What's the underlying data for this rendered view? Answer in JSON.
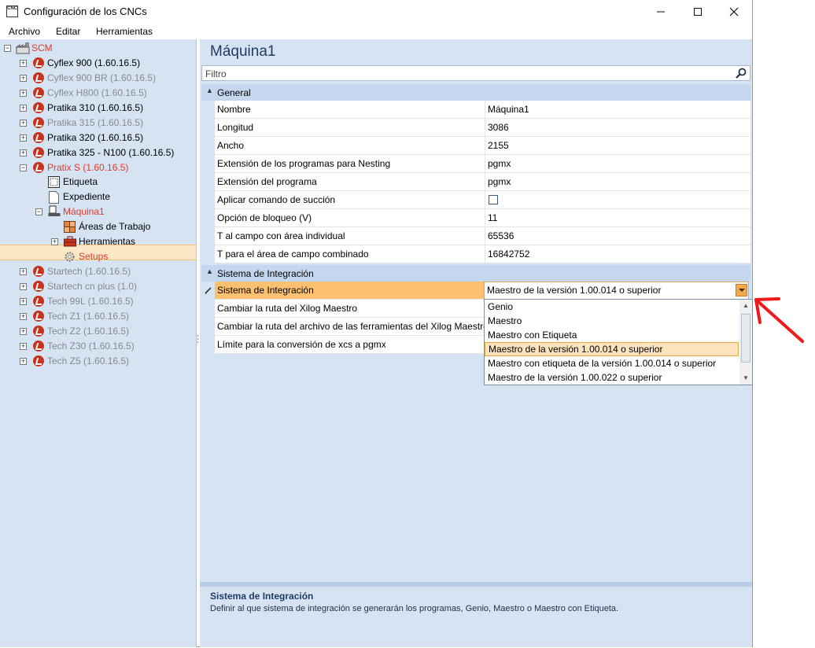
{
  "window": {
    "title": "Configuración de los CNCs",
    "icon_text": "CNC",
    "buttons": {
      "minimize": "—",
      "maximize": "☐",
      "close": "✕"
    }
  },
  "menu": [
    "Archivo",
    "Editar",
    "Herramientas"
  ],
  "tree": {
    "root": "SCM",
    "items": [
      {
        "label": "Cyflex 900 (1.60.16.5)",
        "state": "normal"
      },
      {
        "label": "Cyflex 900 BR (1.60.16.5)",
        "state": "disabled"
      },
      {
        "label": "Cyflex H800 (1.60.16.5)",
        "state": "disabled"
      },
      {
        "label": "Pratika 310 (1.60.16.5)",
        "state": "normal"
      },
      {
        "label": "Pratika 315 (1.60.16.5)",
        "state": "disabled"
      },
      {
        "label": "Pratika 320 (1.60.16.5)",
        "state": "normal"
      },
      {
        "label": "Pratika 325 - N100 (1.60.16.5)",
        "state": "normal"
      },
      {
        "label": "Pratix S (1.60.16.5)",
        "state": "active"
      }
    ],
    "pratix_children": {
      "etiqueta": "Etiqueta",
      "expediente": "Expediente",
      "maquina": "Máquina1",
      "areas": "Áreas de Trabajo",
      "herramientas": "Herramientas",
      "setups": "Setups"
    },
    "items_after": [
      {
        "label": "Startech (1.60.16.5)"
      },
      {
        "label": "Startech cn plus (1.0)"
      },
      {
        "label": "Tech 99L (1.60.16.5)"
      },
      {
        "label": "Tech Z1 (1.60.16.5)"
      },
      {
        "label": "Tech Z2 (1.60.16.5)"
      },
      {
        "label": "Tech Z30 (1.60.16.5)"
      },
      {
        "label": "Tech Z5 (1.60.16.5)"
      }
    ]
  },
  "panel": {
    "title": "Máquina1",
    "filter_placeholder": "Filtro",
    "general_label": "General",
    "general_props": [
      {
        "name": "Nombre",
        "value": "Máquina1"
      },
      {
        "name": "Longitud",
        "value": "3086"
      },
      {
        "name": "Ancho",
        "value": "2155"
      },
      {
        "name": "Extensión de los programas para Nesting",
        "value": "pgmx"
      },
      {
        "name": "Extensión del programa",
        "value": "pgmx"
      },
      {
        "name": "Aplicar comando de succión",
        "value": ""
      },
      {
        "name": "Opción de bloqueo (V)",
        "value": "11"
      },
      {
        "name": "T al campo con área individual",
        "value": "65536"
      },
      {
        "name": "T para el área de campo combinado",
        "value": "16842752"
      }
    ],
    "integration_label": "Sistema de Integración",
    "integration_props": [
      {
        "name": "Sistema de Integración",
        "value": "Maestro de la versión 1.00.014 o superior"
      },
      {
        "name": "Cambiar la ruta del Xilog Maestro",
        "value": ""
      },
      {
        "name": "Cambiar la ruta del archivo de las ferramientas del Xilog Maestro",
        "value": ""
      },
      {
        "name": "Límite para la conversión de xcs a pgmx",
        "value": ""
      }
    ]
  },
  "dropdown": {
    "options": [
      "Genio",
      "Maestro",
      "Maestro con Etiqueta",
      "Maestro de la versión 1.00.014 o superior",
      "Maestro con etiqueta de la versión 1.00.014 o superior",
      "Maestro de la versión 1.00.022 o superior"
    ],
    "selected_index": 3
  },
  "description": {
    "title": "Sistema de Integración",
    "body": "Definir al que sistema de integración se generarán los programas, Genio, Maestro o Maestro con Etiqueta."
  },
  "colors": {
    "panel_bg": "#d6e3f3",
    "active_red": "#e03a2a",
    "disabled_gray": "#8a8a8a",
    "selection_orange": "#fcc170"
  }
}
